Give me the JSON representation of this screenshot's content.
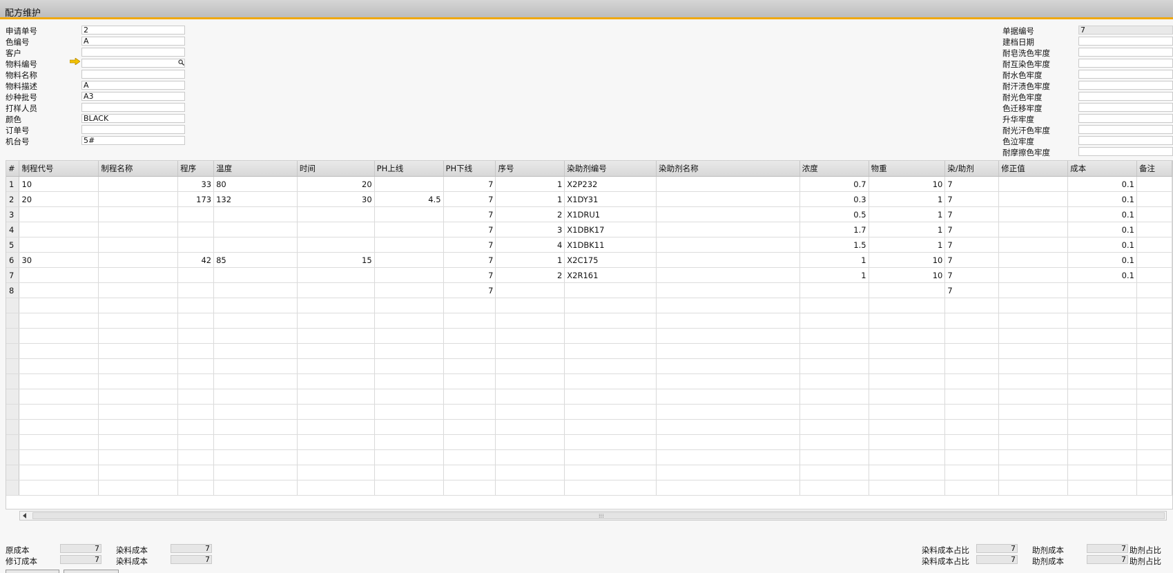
{
  "window": {
    "title": "配方维护"
  },
  "header_left": [
    {
      "label": "申请单号",
      "value": "2"
    },
    {
      "label": "色编号",
      "value": "A"
    },
    {
      "label": "客户",
      "value": ""
    },
    {
      "label": "物料编号",
      "value": ""
    },
    {
      "label": "物料名称",
      "value": ""
    },
    {
      "label": "物料描述",
      "value": "A"
    },
    {
      "label": "纱种批号",
      "value": "A3"
    },
    {
      "label": "打样人员",
      "value": ""
    },
    {
      "label": "颜色",
      "value": "BLACK"
    },
    {
      "label": "订单号",
      "value": ""
    },
    {
      "label": "机台号",
      "value": "5#"
    }
  ],
  "header_right": [
    {
      "label": "单据编号",
      "value": "7"
    },
    {
      "label": "建档日期",
      "value": ""
    },
    {
      "label": "耐皂洗色牢度",
      "value": ""
    },
    {
      "label": "耐互染色牢度",
      "value": ""
    },
    {
      "label": "耐水色牢度",
      "value": ""
    },
    {
      "label": "耐汗渍色牢度",
      "value": ""
    },
    {
      "label": "耐光色牢度",
      "value": ""
    },
    {
      "label": "色迁移牢度",
      "value": ""
    },
    {
      "label": "升华牢度",
      "value": ""
    },
    {
      "label": "耐光汗色牢度",
      "value": ""
    },
    {
      "label": "色泣牢度",
      "value": ""
    },
    {
      "label": "耐摩擦色牢度",
      "value": ""
    }
  ],
  "grid": {
    "columns": [
      "#",
      "制程代号",
      "制程名称",
      "程序",
      "温度",
      "时间",
      "PH上线",
      "PH下线",
      "序号",
      "染助剂编号",
      "染助剂名称",
      "浓度",
      "物重",
      "染/助剂",
      "修正值",
      "成本",
      "备注"
    ],
    "rows": [
      [
        "1",
        "10",
        "",
        "33",
        "80",
        "20",
        "",
        "7",
        "1",
        "X2P232",
        "",
        "0.7",
        "10",
        "7",
        "",
        "0.1",
        ""
      ],
      [
        "2",
        "20",
        "",
        "173",
        "132",
        "30",
        "4.5",
        "7",
        "1",
        "X1DY31",
        "",
        "0.3",
        "1",
        "7",
        "",
        "0.1",
        ""
      ],
      [
        "3",
        "",
        "",
        "",
        "",
        "",
        "",
        "7",
        "2",
        "X1DRU1",
        "",
        "0.5",
        "1",
        "7",
        "",
        "0.1",
        ""
      ],
      [
        "4",
        "",
        "",
        "",
        "",
        "",
        "",
        "7",
        "3",
        "X1DBK17",
        "",
        "1.7",
        "1",
        "7",
        "",
        "0.1",
        ""
      ],
      [
        "5",
        "",
        "",
        "",
        "",
        "",
        "",
        "7",
        "4",
        "X1DBK11",
        "",
        "1.5",
        "1",
        "7",
        "",
        "0.1",
        ""
      ],
      [
        "6",
        "30",
        "",
        "42",
        "85",
        "15",
        "",
        "7",
        "1",
        "X2C175",
        "",
        "1",
        "10",
        "7",
        "",
        "0.1",
        ""
      ],
      [
        "7",
        "",
        "",
        "",
        "",
        "",
        "",
        "7",
        "2",
        "X2R161",
        "",
        "1",
        "10",
        "7",
        "",
        "0.1",
        ""
      ],
      [
        "8",
        "",
        "",
        "",
        "",
        "",
        "",
        "7",
        "",
        "",
        "",
        "",
        "",
        "7",
        "",
        "",
        ""
      ]
    ]
  },
  "footer": {
    "row1": {
      "orig_cost_label": "原成本",
      "orig_cost": "7",
      "dye_cost_label": "染料成本",
      "dye_cost": "7",
      "dye_ratio_label": "染料成本占比",
      "dye_ratio": "7",
      "aux_cost_label": "助剂成本",
      "aux_cost": "7",
      "aux_ratio_label": "助剂占比"
    },
    "row2": {
      "rev_cost_label": "修订成本",
      "rev_cost": "7",
      "dye_cost_label": "染料成本",
      "dye_cost": "7",
      "dye_ratio_label": "染料成本占比",
      "dye_ratio": "7",
      "aux_cost_label": "助剂成本",
      "aux_cost": "7",
      "aux_ratio_label": "助剂占比"
    }
  }
}
